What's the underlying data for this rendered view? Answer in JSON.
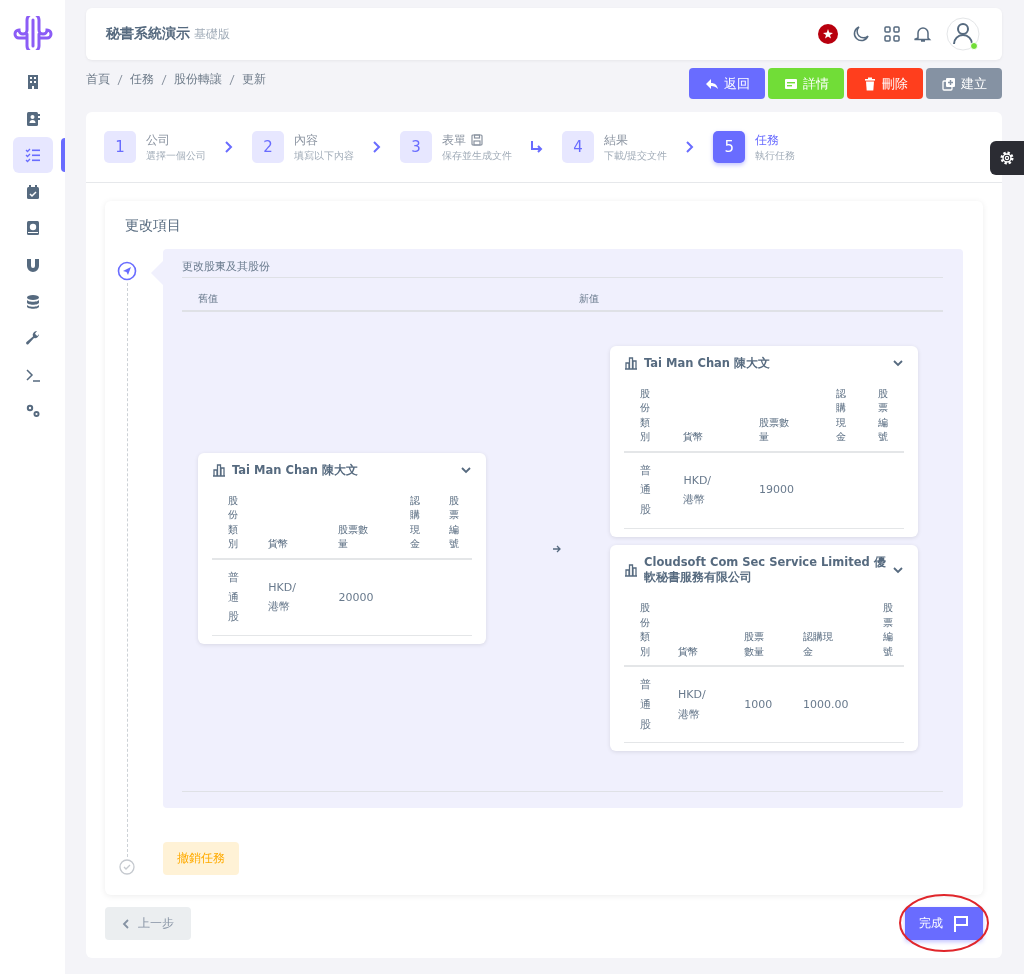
{
  "sidebar": {
    "items": [
      {
        "selected": false
      },
      {
        "selected": false
      },
      {
        "selected": true
      },
      {
        "selected": false
      },
      {
        "selected": false
      },
      {
        "selected": false
      },
      {
        "selected": false
      },
      {
        "selected": false
      },
      {
        "selected": false
      },
      {
        "selected": false
      }
    ]
  },
  "header": {
    "title": "秘書系統演示",
    "edition": "基礎版"
  },
  "breadcrumb": [
    "首頁",
    "任務",
    "股份轉讓",
    "更新"
  ],
  "actions": [
    {
      "label": "返回",
      "kind": "back"
    },
    {
      "label": "詳情",
      "kind": "details"
    },
    {
      "label": "刪除",
      "kind": "delete"
    },
    {
      "label": "建立",
      "kind": "create"
    }
  ],
  "steps": [
    {
      "number": "1",
      "title": "公司",
      "subtitle": "選擇一個公司",
      "selected": false,
      "turn_arrow": false
    },
    {
      "number": "2",
      "title": "內容",
      "subtitle": "填寫以下內容",
      "selected": false,
      "turn_arrow": false
    },
    {
      "number": "3",
      "title": "表單",
      "subtitle": "保存並生成文件",
      "selected": false,
      "saved": true,
      "turn_arrow": true
    },
    {
      "number": "4",
      "title": "結果",
      "subtitle": "下載/提交文件",
      "selected": false,
      "turn_arrow": false
    },
    {
      "number": "5",
      "title": "任務",
      "subtitle": "執行任務",
      "selected": true
    }
  ],
  "section": {
    "title": "更改項目",
    "change_title": "更改股東及其股份",
    "old_label": "舊值",
    "new_label": "新值",
    "old": [
      {
        "name": "Tai Man Chan 陳大文",
        "columns": [
          "股份類別",
          "貨幣",
          "股票數量",
          "認購現金",
          "股票編號"
        ],
        "rows": [
          {
            "share_class": "普通股",
            "currency": "HKD/港幣",
            "quantity": "20000"
          }
        ]
      }
    ],
    "new": [
      {
        "name": "Tai Man Chan 陳大文",
        "columns": [
          "股份類別",
          "貨幣",
          "股票數量",
          "認購現金",
          "股票編號"
        ],
        "rows": [
          {
            "share_class": "普通股",
            "currency": "HKD/港幣",
            "quantity": "19000"
          }
        ]
      },
      {
        "name": "Cloudsoft Com Sec Service Limited 優軟秘書服務有限公司",
        "columns": [
          "股份類別",
          "貨幣",
          "股票數量",
          "認購現金",
          "股票編號"
        ],
        "rows": [
          {
            "share_class": "普通股",
            "currency": "HKD/港幣",
            "quantity": "1000",
            "subscription": "1000.00"
          }
        ]
      }
    ],
    "cancel_button": "撤銷任務"
  },
  "footer": {
    "previous": "上一步",
    "finish": "完成",
    "finish_highlighted": true
  }
}
